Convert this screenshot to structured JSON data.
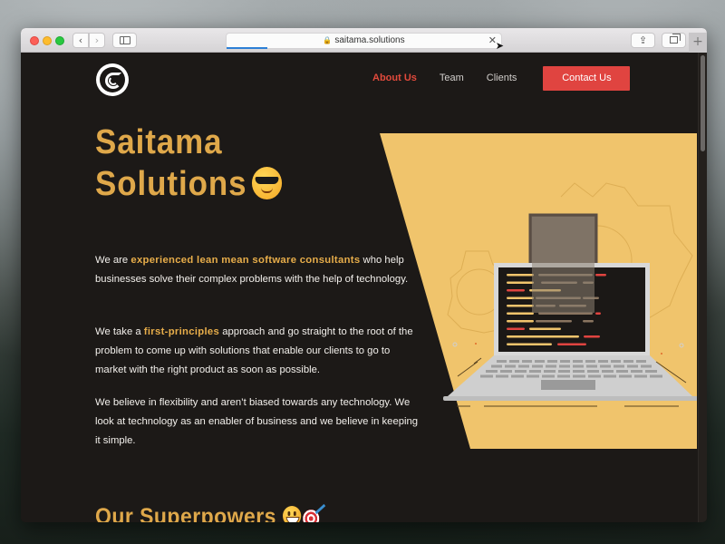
{
  "browser": {
    "url": "saitama.solutions",
    "load_progress_percent": 15,
    "buttons": {
      "close_icon": "close-window-icon",
      "minimize_icon": "minimize-window-icon",
      "maximize_icon": "maximize-window-icon",
      "back": "‹",
      "forward": "›",
      "stop_loading": "✕",
      "share": "⇪",
      "new_tab": "+"
    }
  },
  "site": {
    "logo_alt": "Saitama Solutions logo",
    "nav": {
      "items": [
        {
          "label": "About Us",
          "active": true
        },
        {
          "label": "Team",
          "active": false
        },
        {
          "label": "Clients",
          "active": false
        }
      ],
      "cta_label": "Contact Us"
    },
    "hero": {
      "title_line1": "Saitama",
      "title_line2": "Solutions",
      "title_emoji": "smiling-face-with-sunglasses"
    },
    "paragraphs": [
      {
        "before": "We are ",
        "highlight": "experienced lean mean software consultants",
        "after": " who help businesses solve their complex problems with the help of technology."
      },
      {
        "before": "We take a ",
        "highlight": "first-principles",
        "after": " approach and go straight to the root of the problem to come up with solutions that enable our clients to go to market with the right product as soon as possible."
      },
      {
        "text": "We believe in flexibility and aren’t biased towards any technology. We look at technology as an enabler of business and we believe in keeping it simple."
      }
    ],
    "superpowers": {
      "title": "Our Superpowers",
      "emojis": [
        "grinning-face",
        "direct-hit-target"
      ]
    }
  },
  "colors": {
    "page_bg": "#1c1917",
    "accent_gold": "#dfa84a",
    "highlight_gold": "#e7ad4a",
    "cta_red": "#e04440",
    "active_nav_red": "#e24a3c",
    "illustration_yellow": "#f0c46c"
  }
}
